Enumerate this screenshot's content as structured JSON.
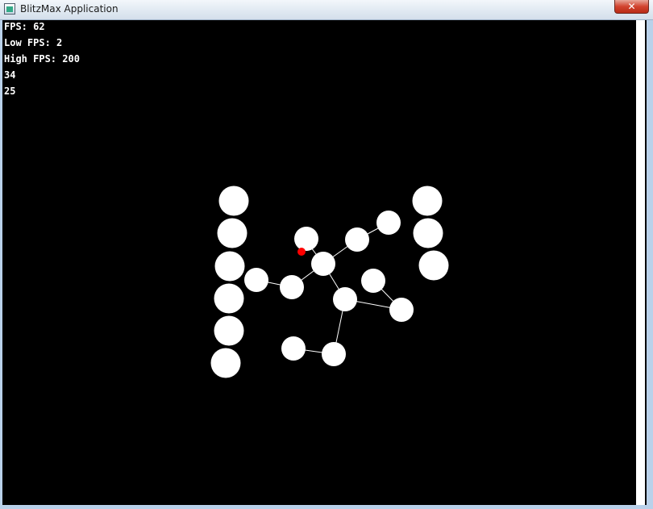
{
  "window": {
    "title": "BlitzMax Application",
    "icon": "app-window-icon",
    "close_icon": "close-icon",
    "close_glyph": "✕"
  },
  "hud": {
    "fps": "FPS: 62",
    "low_fps": "Low FPS: 2",
    "high_fps": "High FPS: 200",
    "value_a": "34",
    "value_b": "25"
  },
  "colors": {
    "background": "#000000",
    "ball": "#ffffff",
    "marker": "#ff0000",
    "link": "#ffffff"
  }
}
